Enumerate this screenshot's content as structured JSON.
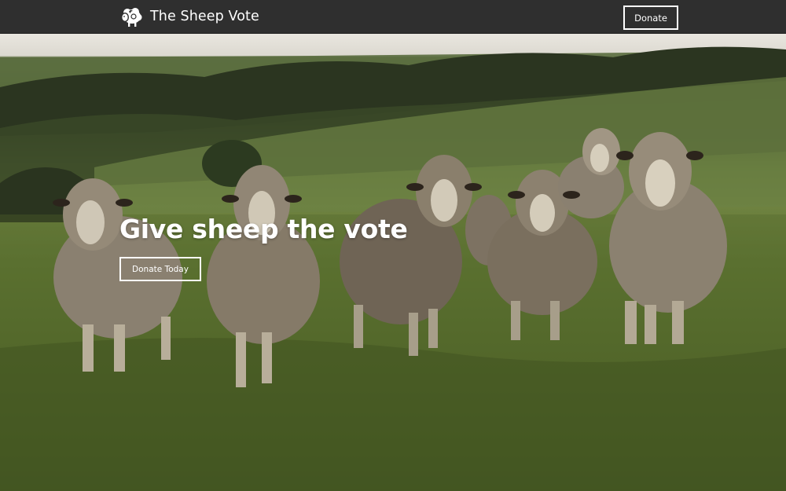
{
  "navbar": {
    "brand_name": "The Sheep Vote",
    "logo_icon": "sheep-icon",
    "donate_label": "Donate",
    "background": "#2f2f2f"
  },
  "hero": {
    "title": "Give sheep the vote",
    "cta_label": "Donate Today",
    "image_subject": "flock of sheep in a green field",
    "text_color": "#ffffff"
  }
}
